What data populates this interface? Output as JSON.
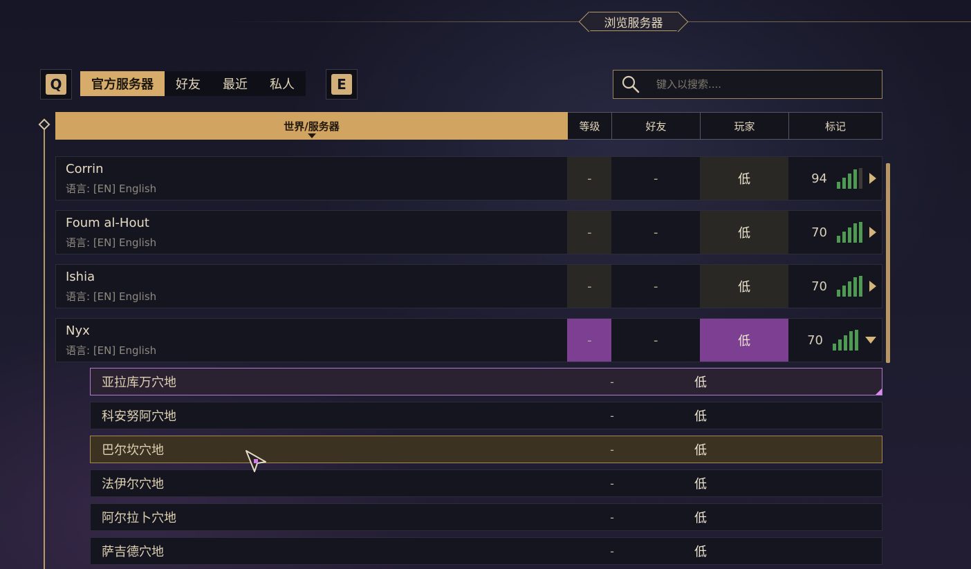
{
  "title": "浏览服务器",
  "keys": {
    "left": "Q",
    "right": "E"
  },
  "tabs": [
    {
      "label": "官方服务器",
      "active": true
    },
    {
      "label": "好友",
      "active": false
    },
    {
      "label": "最近",
      "active": false
    },
    {
      "label": "私人",
      "active": false
    }
  ],
  "search": {
    "placeholder": "键入以搜索...."
  },
  "columns": {
    "world": "世界/服务器",
    "level": "等级",
    "friends": "好友",
    "players": "玩家",
    "tags": "标记"
  },
  "servers": [
    {
      "name": "Corrin",
      "language": "语言: [EN] English",
      "level": "-",
      "friends": "-",
      "players": "低",
      "ping": "94",
      "signal_bars": 4,
      "expanded": false
    },
    {
      "name": "Foum al-Hout",
      "language": "语言: [EN] English",
      "level": "-",
      "friends": "-",
      "players": "低",
      "ping": "70",
      "signal_bars": 5,
      "expanded": false
    },
    {
      "name": "Ishia",
      "language": "语言: [EN] English",
      "level": "-",
      "friends": "-",
      "players": "低",
      "ping": "70",
      "signal_bars": 5,
      "expanded": false
    },
    {
      "name": "Nyx",
      "language": "语言: [EN] English",
      "level": "-",
      "friends": "-",
      "players": "低",
      "ping": "70",
      "signal_bars": 5,
      "expanded": true
    }
  ],
  "sub_servers": [
    {
      "name": "亚拉库万穴地",
      "friends": "-",
      "players": "低",
      "state": "selected"
    },
    {
      "name": "科安努阿穴地",
      "friends": "-",
      "players": "低",
      "state": "normal"
    },
    {
      "name": "巴尔坎穴地",
      "friends": "-",
      "players": "低",
      "state": "hover"
    },
    {
      "name": "法伊尔穴地",
      "friends": "-",
      "players": "低",
      "state": "normal"
    },
    {
      "name": "阿尔拉卜穴地",
      "friends": "-",
      "players": "低",
      "state": "normal"
    },
    {
      "name": "萨吉德穴地",
      "friends": "-",
      "players": "低",
      "state": "normal"
    }
  ],
  "colors": {
    "accent": "#d1a461",
    "expanded": "#7d3f92",
    "signal": "#4f9a52"
  }
}
